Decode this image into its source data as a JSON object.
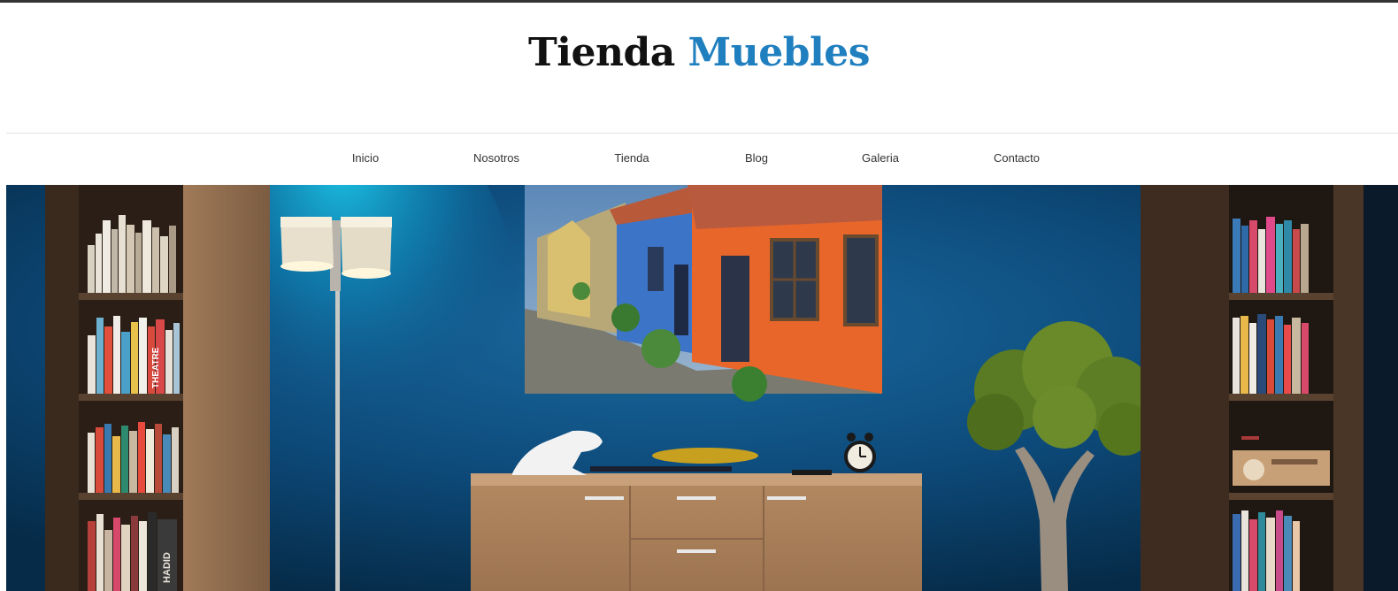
{
  "header": {
    "title_part1": "Tienda",
    "title_part2": "Muebles",
    "accent_color": "#1f7fbf"
  },
  "nav": {
    "items": [
      {
        "label": "Inicio"
      },
      {
        "label": "Nosotros"
      },
      {
        "label": "Tienda"
      },
      {
        "label": "Blog"
      },
      {
        "label": "Galeria"
      },
      {
        "label": "Contacto"
      }
    ]
  },
  "hero": {
    "spine_text_1": "THEATRE",
    "spine_text_2": "HADID"
  }
}
